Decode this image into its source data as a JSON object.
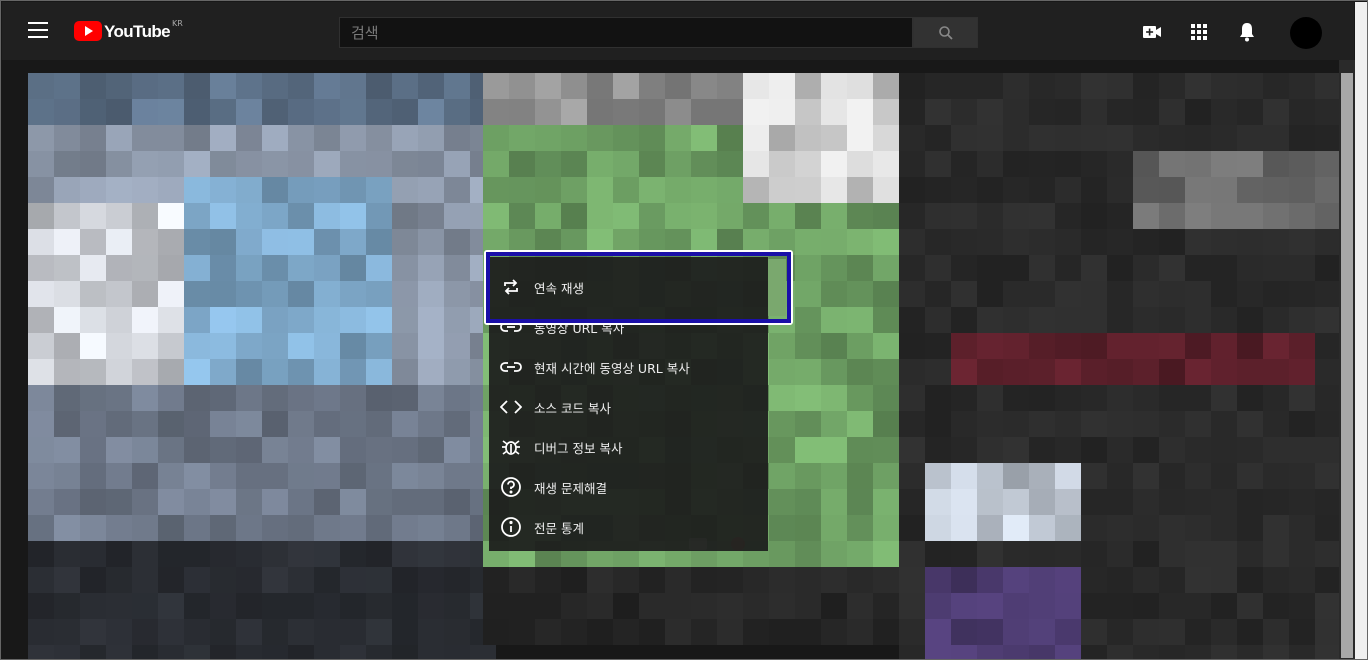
{
  "header": {
    "logo_text": "YouTube",
    "logo_country": "KR",
    "search_placeholder": "검색"
  },
  "icons": {
    "menu": "hamburger-menu-icon",
    "search": "search-icon",
    "create": "video-camera-plus-icon",
    "apps": "grid-apps-icon",
    "notifications": "bell-icon",
    "account": "avatar"
  },
  "context_menu": {
    "items": [
      {
        "label": "연속 재생",
        "icon": "loop-icon"
      },
      {
        "label": "동영상 URL 복사",
        "icon": "link-icon"
      },
      {
        "label": "현재 시간에 동영상 URL 복사",
        "icon": "link-icon"
      },
      {
        "label": "소스 코드 복사",
        "icon": "code-icon"
      },
      {
        "label": "디버그 정보 복사",
        "icon": "bug-icon"
      },
      {
        "label": "재생 문제해결",
        "icon": "help-circle-icon"
      },
      {
        "label": "전문 통계",
        "icon": "info-circle-icon"
      }
    ]
  },
  "colors": {
    "brand_red": "#ff0000",
    "highlight_blue": "#1a0fa8",
    "header_bg": "#202020"
  }
}
